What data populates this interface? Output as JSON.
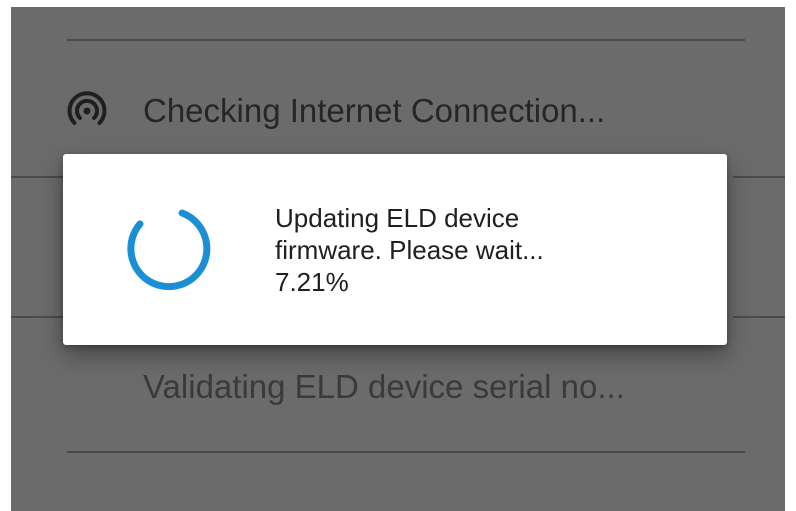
{
  "background_list": {
    "rows": [
      {
        "icon": "wifi-signal-icon",
        "text": "Checking Internet Connection..."
      },
      {
        "icon": "",
        "text": "Validating ELD device serial no..."
      }
    ]
  },
  "dialog": {
    "spinner_icon": "progress-spinner-icon",
    "message_line_1": "Updating ELD device",
    "message_line_2": "firmware. Please wait...",
    "progress_text": "7.21%",
    "progress_percent": 7.21
  },
  "colors": {
    "overlay": "#6b6b6b",
    "dialog_background": "#ffffff",
    "spinner_accent": "#1a8fd6",
    "text_primary": "#202020"
  }
}
